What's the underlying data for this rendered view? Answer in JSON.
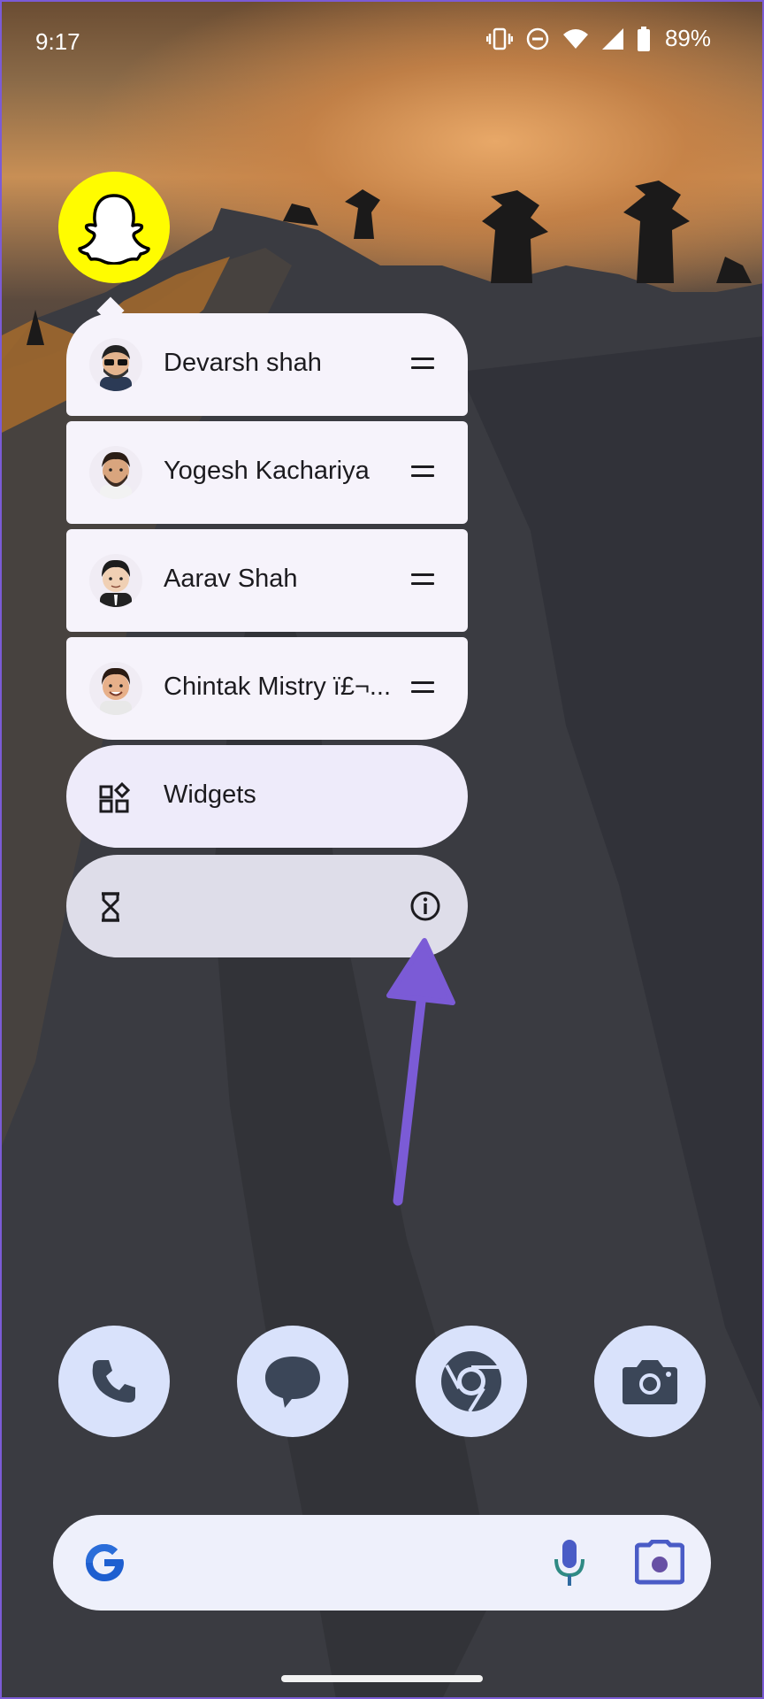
{
  "status_bar": {
    "time": "9:17",
    "battery_percent": "89%",
    "icons": [
      "vibrate-icon",
      "do-not-disturb-icon",
      "wifi-icon",
      "cell-signal-icon",
      "battery-icon"
    ]
  },
  "app": {
    "icon": "snapchat-ghost-icon",
    "icon_color": "#fffc00"
  },
  "shortcuts": {
    "items": [
      {
        "label": "Devarsh shah",
        "avatar": "bitmoji-avatar-sunglasses"
      },
      {
        "label": "Yogesh Kachariya",
        "avatar": "bitmoji-avatar-beard"
      },
      {
        "label": "Aarav Shah",
        "avatar": "bitmoji-avatar-suit"
      },
      {
        "label": "Chintak Mistry ï£¬...",
        "avatar": "bitmoji-avatar-smile"
      }
    ],
    "widgets_label": "Widgets",
    "app_info_icons": [
      "hourglass-icon",
      "info-icon"
    ]
  },
  "annotation": {
    "type": "arrow",
    "color": "#7b5bd6"
  },
  "dock": {
    "apps": [
      "phone-icon",
      "messages-icon",
      "chrome-icon",
      "camera-icon"
    ],
    "app_bg": "#d9e2fb"
  },
  "search_bar": {
    "icons": [
      "google-g-icon",
      "microphone-icon",
      "google-lens-icon"
    ]
  }
}
